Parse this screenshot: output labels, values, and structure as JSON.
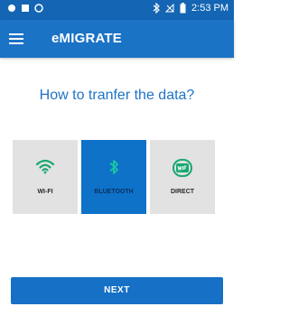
{
  "status_bar": {
    "time": "2:53 PM"
  },
  "toolbar": {
    "title": "eMIGRATE"
  },
  "question": "How to tranfer the data?",
  "options": [
    {
      "label": "WI-FI",
      "icon": "wifi-icon",
      "selected": false
    },
    {
      "label": "BLUETOOTH",
      "icon": "bluetooth-icon",
      "selected": true
    },
    {
      "label": "DIRECT",
      "icon": "wifi-direct-icon",
      "selected": false
    }
  ],
  "next_label": "NEXT",
  "colors": {
    "primary": "#1b73c6",
    "selected": "#0e72c9",
    "accent": "#19a870"
  }
}
